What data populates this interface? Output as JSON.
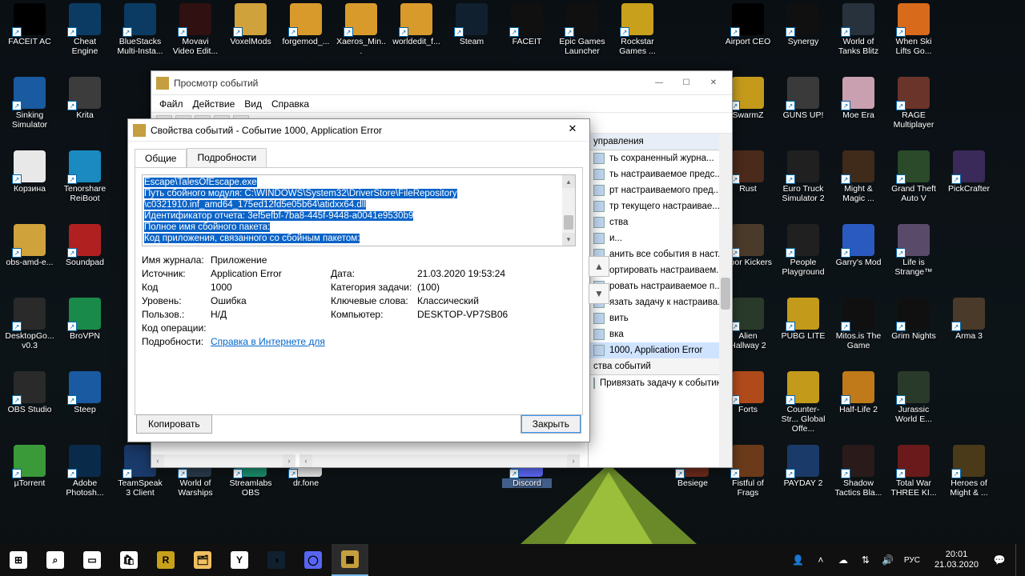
{
  "os": {
    "language_ind": "РУС",
    "time": "20:01",
    "date": "21.03.2020"
  },
  "desktop_icons": [
    {
      "col": 0,
      "row": 0,
      "label": "FACEIT AC",
      "color": "#000"
    },
    {
      "col": 1,
      "row": 0,
      "label": "Cheat Engine",
      "color": "#0b3b63"
    },
    {
      "col": 2,
      "row": 0,
      "label": "BlueStacks Multi-Insta...",
      "color": "#0b3b63"
    },
    {
      "col": 3,
      "row": 0,
      "label": "Movavi Video Edit...",
      "color": "#301010"
    },
    {
      "col": 4,
      "row": 0,
      "label": "VoxelMods",
      "color": "#d0a23c"
    },
    {
      "col": 5,
      "row": 0,
      "label": "forgemod_...",
      "color": "#d89a2b"
    },
    {
      "col": 6,
      "row": 0,
      "label": "Xaeros_Min...",
      "color": "#d89a2b"
    },
    {
      "col": 7,
      "row": 0,
      "label": "worldedit_f...",
      "color": "#d89a2b"
    },
    {
      "col": 8,
      "row": 0,
      "label": "Steam",
      "color": "#10202f"
    },
    {
      "col": 9,
      "row": 0,
      "label": "FACEIT",
      "color": "#101010"
    },
    {
      "col": 10,
      "row": 0,
      "label": "Epic Games Launcher",
      "color": "#101010"
    },
    {
      "col": 11,
      "row": 0,
      "label": "Rockstar Games ...",
      "color": "#c9a01b"
    },
    {
      "col": 13,
      "row": 0,
      "label": "Airport CEO",
      "color": "#000"
    },
    {
      "col": 14,
      "row": 0,
      "label": "Synergy",
      "color": "#101010"
    },
    {
      "col": 15,
      "row": 0,
      "label": "World of Tanks Blitz",
      "color": "#28323c"
    },
    {
      "col": 16,
      "row": 0,
      "label": "When Ski Lifts Go...",
      "color": "#d86a1b"
    },
    {
      "col": 0,
      "row": 1,
      "label": "Sinking Simulator",
      "color": "#1a5aa0"
    },
    {
      "col": 1,
      "row": 1,
      "label": "Krita",
      "color": "#3c3c3c"
    },
    {
      "col": 13,
      "row": 1,
      "label": "SwarmZ",
      "color": "#c49a1b"
    },
    {
      "col": 14,
      "row": 1,
      "label": "GUNS UP!",
      "color": "#3a3a3a"
    },
    {
      "col": 15,
      "row": 1,
      "label": "Moe Era",
      "color": "#c9a0b0"
    },
    {
      "col": 16,
      "row": 1,
      "label": "RAGE Multiplayer",
      "color": "#6a342a"
    },
    {
      "col": 0,
      "row": 2,
      "label": "Корзина",
      "color": "#e8e8e8"
    },
    {
      "col": 1,
      "row": 2,
      "label": "Tenorshare ReiBoot",
      "color": "#1a8ac0"
    },
    {
      "col": 13,
      "row": 2,
      "label": "Rust",
      "color": "#4a2a1a"
    },
    {
      "col": 14,
      "row": 2,
      "label": "Euro Truck Simulator 2",
      "color": "#202020"
    },
    {
      "col": 15,
      "row": 2,
      "label": "Might & Magic ...",
      "color": "#402a1a"
    },
    {
      "col": 16,
      "row": 2,
      "label": "Grand Theft Auto V",
      "color": "#2a4a2a"
    },
    {
      "col": 17,
      "row": 2,
      "label": "PickCrafter",
      "color": "#3a2a5a"
    },
    {
      "col": 0,
      "row": 3,
      "label": "obs-amd-e...",
      "color": "#d0a23c"
    },
    {
      "col": 1,
      "row": 3,
      "label": "Soundpad",
      "color": "#b02020"
    },
    {
      "col": 13,
      "row": 3,
      "label": "Door Kickers",
      "color": "#4a3a2a"
    },
    {
      "col": 14,
      "row": 3,
      "label": "People Playground",
      "color": "#202020"
    },
    {
      "col": 15,
      "row": 3,
      "label": "Garry's Mod",
      "color": "#2a5ac0"
    },
    {
      "col": 16,
      "row": 3,
      "label": "Life is Strange™",
      "color": "#5a4a6a"
    },
    {
      "col": 0,
      "row": 4,
      "label": "DesktopGo... v0.3",
      "color": "#2a2a2a"
    },
    {
      "col": 1,
      "row": 4,
      "label": "BroVPN",
      "color": "#1a8a4a"
    },
    {
      "col": 13,
      "row": 4,
      "label": "Alien Hallway 2",
      "color": "#2a3a2a"
    },
    {
      "col": 14,
      "row": 4,
      "label": "PUBG LITE",
      "color": "#c49a1b"
    },
    {
      "col": 15,
      "row": 4,
      "label": "Mitos.is The Game",
      "color": "#101010"
    },
    {
      "col": 16,
      "row": 4,
      "label": "Grim Nights",
      "color": "#101010"
    },
    {
      "col": 17,
      "row": 4,
      "label": "Arma 3",
      "color": "#4a3a2a"
    },
    {
      "col": 0,
      "row": 5,
      "label": "OBS Studio",
      "color": "#2a2a2a"
    },
    {
      "col": 1,
      "row": 5,
      "label": "Steep",
      "color": "#1a5aa0"
    },
    {
      "col": 13,
      "row": 5,
      "label": "Forts",
      "color": "#b04a1a"
    },
    {
      "col": 14,
      "row": 5,
      "label": "Counter-Str... Global Offe...",
      "color": "#c49a1b"
    },
    {
      "col": 15,
      "row": 5,
      "label": "Half-Life 2",
      "color": "#c07a1a"
    },
    {
      "col": 16,
      "row": 5,
      "label": "Jurassic World E...",
      "color": "#2a3a2a"
    },
    {
      "col": 0,
      "row": 6,
      "label": "µTorrent",
      "color": "#3a9a3a"
    },
    {
      "col": 1,
      "row": 6,
      "label": "Adobe Photosh...",
      "color": "#0a2a4a"
    },
    {
      "col": 2,
      "row": 6,
      "label": "TeamSpeak 3 Client",
      "color": "#1a3a6a"
    },
    {
      "col": 3,
      "row": 6,
      "label": "World of Warships",
      "color": "#2a3a4a"
    },
    {
      "col": 4,
      "row": 6,
      "label": "Streamlabs OBS",
      "color": "#1a8a6a"
    },
    {
      "col": 5,
      "row": 6,
      "label": "dr.fone",
      "color": "#e0e0e0"
    },
    {
      "col": 9,
      "row": 6,
      "label": "Discord",
      "color": "#5865F2",
      "selected": true
    },
    {
      "col": 12,
      "row": 6,
      "label": "Besiege",
      "color": "#6a2a1a"
    },
    {
      "col": 13,
      "row": 6,
      "label": "Fistful of Frags",
      "color": "#6a3a1a"
    },
    {
      "col": 14,
      "row": 6,
      "label": "PAYDAY 2",
      "color": "#1a3a6a"
    },
    {
      "col": 15,
      "row": 6,
      "label": "Shadow Tactics Bla...",
      "color": "#2a1a1a"
    },
    {
      "col": 16,
      "row": 6,
      "label": "Total War THREE KI...",
      "color": "#6a1a1a"
    },
    {
      "col": 17,
      "row": 6,
      "label": "Heroes of Might & ...",
      "color": "#4a3a1a"
    }
  ],
  "event_viewer": {
    "title": "Просмотр событий",
    "menu": [
      "Файл",
      "Действие",
      "Вид",
      "Справка"
    ],
    "actions_header": "управления",
    "actions": [
      {
        "t": "ть сохраненный журна...",
        "sub": false
      },
      {
        "t": "ть настраиваемое предс...",
        "sub": false
      },
      {
        "t": "рт настраиваемого пред...",
        "sub": false
      },
      {
        "t": "тр текущего настраивае...",
        "sub": false
      },
      {
        "t": "ства",
        "sub": true
      },
      {
        "t": "и...",
        "sub": false
      },
      {
        "t": "анить все события в наст...",
        "sub": false
      },
      {
        "t": "ортировать настраиваем...",
        "sub": false
      },
      {
        "t": "ровать настраиваемое п...",
        "sub": false
      },
      {
        "t": "язать задачу к настраива...",
        "sub": false
      },
      {
        "t": "вить",
        "sub": true
      },
      {
        "t": "вка",
        "sub": true
      }
    ],
    "selected_event": "1000, Application Error",
    "actions_footer_header": "ства событий",
    "actions_footer_item": "Привязать задачу к событию..."
  },
  "properties": {
    "title": "Свойства событий - Событие 1000, Application Error",
    "tabs": [
      "Общие",
      "Подробности"
    ],
    "log_lines": [
      "Escape\\TalesOfEscape.exe",
      "Путь сбойного модуля: C:\\WINDOWS\\System32\\DriverStore\\FileRepository",
      "\\c0321910.inf_amd64_175ed12fd5e05b64\\atidxx64.dll",
      "Идентификатор отчета: 3ef5efbf-7ba8-445f-9448-a0041e9530b9",
      "Полное имя сбойного пакета:",
      "Код приложения, связанного со сбойным пакетом:"
    ],
    "fields": {
      "log_name_l": "Имя журнала:",
      "log_name_v": "Приложение",
      "source_l": "Источник:",
      "source_v": "Application Error",
      "date_l": "Дата:",
      "date_v": "21.03.2020 19:53:24",
      "code_l": "Код",
      "code_v": "1000",
      "taskcat_l": "Категория задачи:",
      "taskcat_v": "(100)",
      "level_l": "Уровень:",
      "level_v": "Ошибка",
      "keywords_l": "Ключевые слова:",
      "keywords_v": "Классический",
      "user_l": "Пользов.:",
      "user_v": "Н/Д",
      "computer_l": "Компьютер:",
      "computer_v": "DESKTOP-VP7SB06",
      "opcode_l": "Код операции:",
      "opcode_v": "",
      "details_l": "Подробности:",
      "details_link": "Справка в Интернете для "
    },
    "buttons": {
      "copy": "Копировать",
      "close": "Закрыть"
    }
  },
  "taskbar": {
    "pinned": [
      {
        "name": "start",
        "color": "#fff"
      },
      {
        "name": "search",
        "color": "#fff"
      },
      {
        "name": "taskview",
        "color": "#fff"
      },
      {
        "name": "store",
        "color": "#fff"
      },
      {
        "name": "rockstar",
        "color": "#c9a01b"
      },
      {
        "name": "explorer",
        "color": "#f0c060"
      },
      {
        "name": "yandex",
        "color": "#fff"
      },
      {
        "name": "steam",
        "color": "#10202f"
      },
      {
        "name": "discord",
        "color": "#5865F2"
      },
      {
        "name": "eventviewer",
        "color": "#c49e3f",
        "active": true
      }
    ]
  }
}
